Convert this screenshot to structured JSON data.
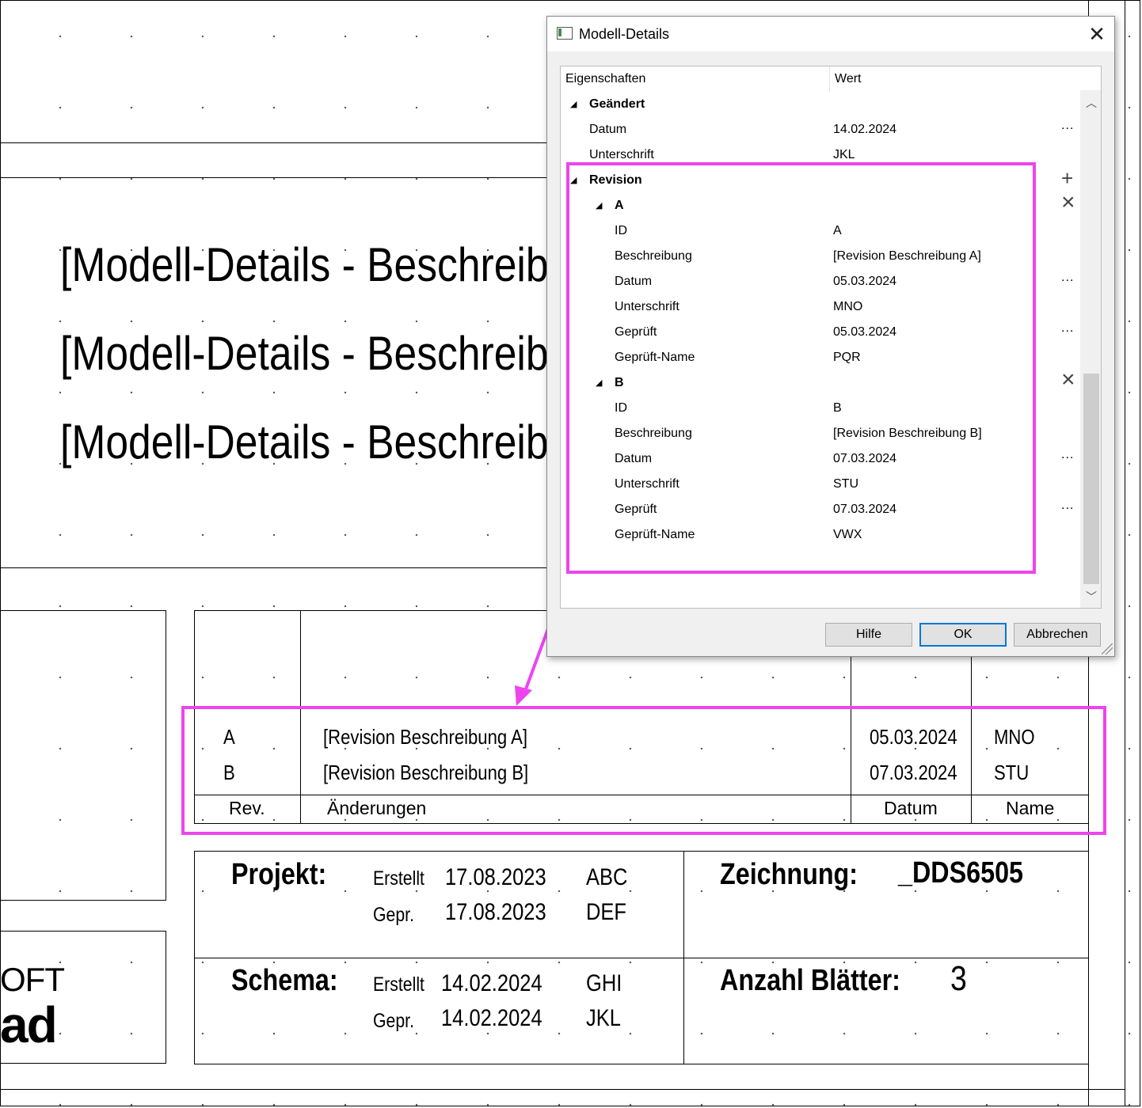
{
  "canvas": {
    "description_lines": [
      "[Modell-Details - Beschreibu",
      "[Modell-Details - Beschreibu",
      "[Modell-Details - Beschreibu"
    ],
    "logo_line1": "OFT",
    "logo_line2": "ad"
  },
  "revision_table": {
    "rows": [
      {
        "rev": "A",
        "desc": "[Revision Beschreibung A]",
        "datum": "05.03.2024",
        "name": "MNO"
      },
      {
        "rev": "B",
        "desc": "[Revision Beschreibung B]",
        "datum": "07.03.2024",
        "name": "STU"
      }
    ],
    "headers": {
      "rev": "Rev.",
      "changes": "Änderungen",
      "datum": "Datum",
      "name": "Name"
    }
  },
  "title_block": {
    "projekt_label": "Projekt:",
    "schema_label": "Schema:",
    "zeichnung_label": "Zeichnung:",
    "zeichnung_value": "_DDS6505",
    "anzahl_label": "Anzahl Blätter:",
    "anzahl_value": "3",
    "projekt": {
      "erstellt_label": "Erstellt",
      "erstellt_date": "17.08.2023",
      "erstellt_name": "ABC",
      "gepr_label": "Gepr.",
      "gepr_date": "17.08.2023",
      "gepr_name": "DEF"
    },
    "schema": {
      "erstellt_label": "Erstellt",
      "erstellt_date": "14.02.2024",
      "erstellt_name": "GHI",
      "gepr_label": "Gepr.",
      "gepr_date": "14.02.2024",
      "gepr_name": "JKL"
    }
  },
  "dialog": {
    "title": "Modell-Details",
    "col_properties": "Eigenschaften",
    "col_value": "Wert",
    "group_changed": "Geändert",
    "changed_datum_label": "Datum",
    "changed_datum_value": "14.02.2024",
    "changed_sig_label": "Unterschrift",
    "changed_sig_value": "JKL",
    "group_revision": "Revision",
    "revisions": [
      {
        "id_header": "A",
        "fields": [
          {
            "label": "ID",
            "value": "A"
          },
          {
            "label": "Beschreibung",
            "value": "[Revision Beschreibung A]"
          },
          {
            "label": "Datum",
            "value": "05.03.2024"
          },
          {
            "label": "Unterschrift",
            "value": "MNO"
          },
          {
            "label": "Geprüft",
            "value": "05.03.2024"
          },
          {
            "label": "Geprüft-Name",
            "value": "PQR"
          }
        ]
      },
      {
        "id_header": "B",
        "fields": [
          {
            "label": "ID",
            "value": "B"
          },
          {
            "label": "Beschreibung",
            "value": "[Revision Beschreibung B]"
          },
          {
            "label": "Datum",
            "value": "07.03.2024"
          },
          {
            "label": "Unterschrift",
            "value": "STU"
          },
          {
            "label": "Geprüft",
            "value": "07.03.2024"
          },
          {
            "label": "Geprüft-Name",
            "value": "VWX"
          }
        ]
      }
    ],
    "buttons": {
      "help": "Hilfe",
      "ok": "OK",
      "cancel": "Abbrechen"
    },
    "ellipsis": "...",
    "plus_glyph": "+",
    "remove_glyph": "×",
    "expand_glyph": "◢",
    "close_glyph": "✕",
    "scroll_up": "︿",
    "scroll_down": "﹀"
  },
  "colors": {
    "highlight": "#ee44ee",
    "ok_border": "#0078d7"
  }
}
